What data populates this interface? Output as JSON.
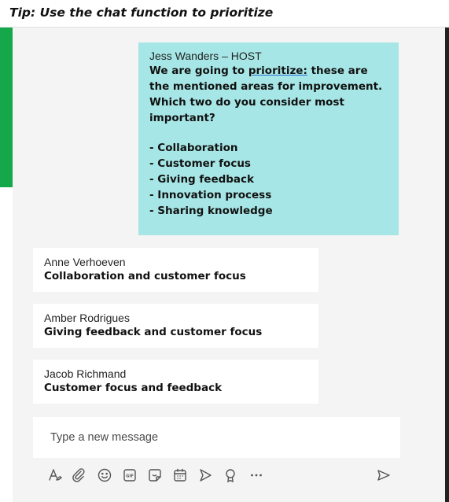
{
  "tip": {
    "text": "Tip: Use the chat function to prioritize"
  },
  "host_message": {
    "sender": "Jess Wanders – HOST",
    "line1_prefix": "We are going to ",
    "line1_link": "prioritize:",
    "line1_suffix": " these are the mentioned areas for improvement. Which two do you consider most important?",
    "options": [
      "- Collaboration",
      "- Customer focus",
      "- Giving feedback",
      "- Innovation process",
      "- Sharing knowledge"
    ]
  },
  "replies": [
    {
      "sender": "Anne Verhoeven",
      "message": "Collaboration and customer focus"
    },
    {
      "sender": "Amber Rodrigues",
      "message": "Giving feedback and customer focus"
    },
    {
      "sender": "Jacob Richmand",
      "message": "Customer focus and feedback"
    }
  ],
  "compose": {
    "placeholder": "Type a new message"
  },
  "toolbar_icons": [
    "format-icon",
    "attach-icon",
    "emoji-icon",
    "gif-icon",
    "sticker-icon",
    "schedule-meeting-icon",
    "stream-icon",
    "praise-icon",
    "more-options-icon",
    "send-icon"
  ],
  "colors": {
    "accent_green": "#15a84a",
    "host_bubble": "#a7e6e6",
    "pane_background": "#f4f4f4"
  }
}
